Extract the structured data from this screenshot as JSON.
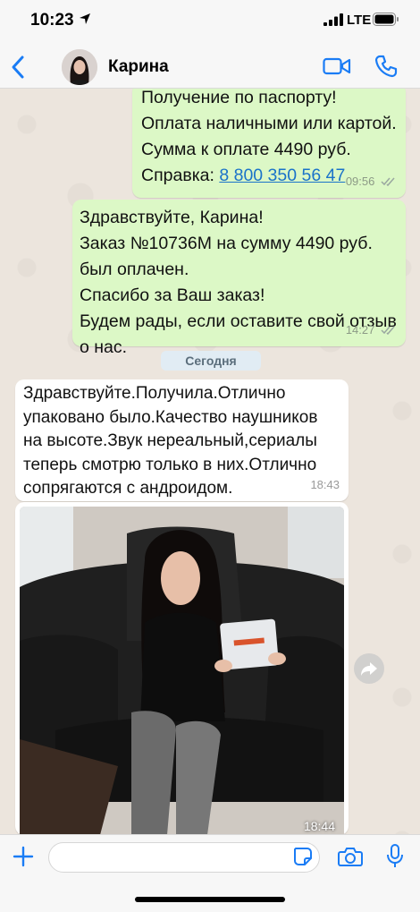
{
  "status_bar": {
    "time": "10:23",
    "network": "LTE"
  },
  "header": {
    "contact_name": "Карина"
  },
  "messages": [
    {
      "direction": "outgoing",
      "lines": [
        "Получение по паспорту!",
        "Оплата наличными или картой.",
        "Сумма к оплате 4490 руб."
      ],
      "ref_label": "Справка: ",
      "ref_link": "8 800 350 56 47",
      "time": "09:56"
    },
    {
      "direction": "outgoing",
      "lines": [
        "Здравствуйте, Карина!",
        "Заказ №10736М на сумму 4490 руб.",
        "был оплачен.",
        "Спасибо за Ваш заказ!",
        "Будем рады, если оставите свой отзыв",
        "о нас."
      ],
      "time": "14:27"
    },
    {
      "direction": "incoming",
      "lines": [
        "Здравствуйте.Получила.Отлично",
        "упаковано было.Качество наушников",
        "на высоте.Звук нереальный,сериалы",
        "теперь смотрю только в них.Отлично",
        "сопрягаются с андроидом."
      ],
      "time": "18:43"
    },
    {
      "direction": "incoming",
      "type": "photo",
      "time": "18:44"
    }
  ],
  "day_separator": "Сегодня",
  "colors": {
    "outgoing_bubble": "#dcf8c6",
    "incoming_bubble": "#ffffff",
    "accent": "#1a7cf5",
    "chat_background": "#ece5dd"
  },
  "icons": [
    "location-arrow-icon",
    "signal-icon",
    "battery-icon",
    "back-chevron-icon",
    "video-call-icon",
    "phone-call-icon",
    "double-check-icon",
    "forward-icon",
    "plus-icon",
    "sticker-icon",
    "camera-icon",
    "microphone-icon"
  ]
}
